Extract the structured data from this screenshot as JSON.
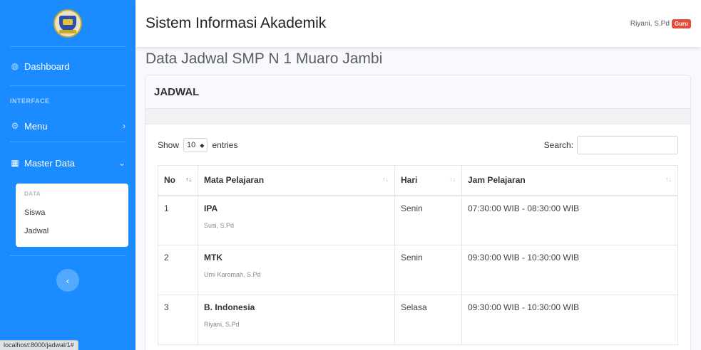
{
  "topbar": {
    "title": "Sistem Informasi Akademik",
    "user_name": "Riyani, S.Pd",
    "user_role": "Guru"
  },
  "sidebar": {
    "dashboard": "Dashboard",
    "interface_heading": "INTERFACE",
    "menu": "Menu",
    "master_data": "Master Data",
    "data_heading": "DATA",
    "siswa": "Siswa",
    "jadwal": "Jadwal"
  },
  "page_title": "Data Jadwal SMP N 1 Muaro Jambi",
  "card": {
    "header": "JADWAL"
  },
  "controls": {
    "show": "Show",
    "length": "10",
    "entries": "entries",
    "search_label": "Search:"
  },
  "table": {
    "headers": [
      "No",
      "Mata Pelajaran",
      "Hari",
      "Jam Pelajaran"
    ],
    "rows": [
      {
        "no": "1",
        "subject": "IPA",
        "teacher": "Susi, S.Pd",
        "day": "Senin",
        "time": "07:30:00 WIB - 08:30:00 WIB"
      },
      {
        "no": "2",
        "subject": "MTK",
        "teacher": "Umi Karomah, S.Pd",
        "day": "Senin",
        "time": "09:30:00 WIB - 10:30:00 WIB"
      },
      {
        "no": "3",
        "subject": "B. Indonesia",
        "teacher": "Riyani, S.Pd",
        "day": "Selasa",
        "time": "09:30:00 WIB - 10:30:00 WIB"
      }
    ]
  },
  "statusbar": "localhost:8000/jadwal/1#"
}
